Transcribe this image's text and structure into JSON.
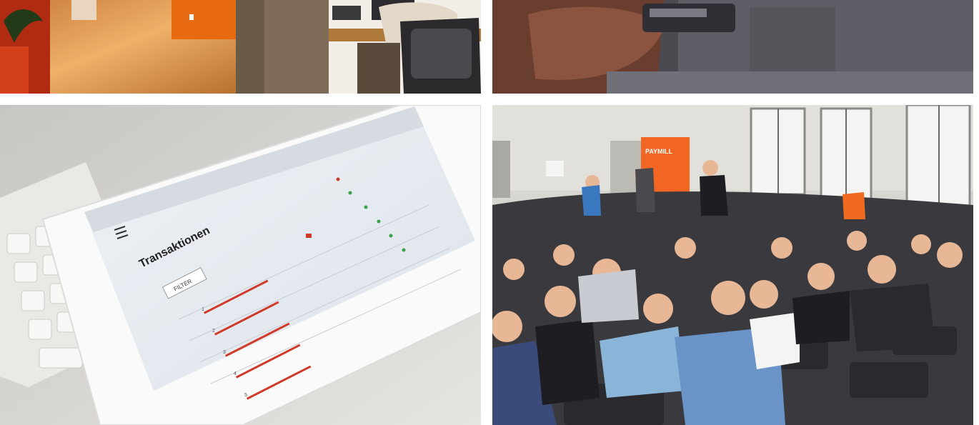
{
  "photos": {
    "office": {
      "icon": "office-desk-photo"
    },
    "printer": {
      "icon": "card-terminal-photo"
    },
    "ipad": {
      "icon": "ipad-on-keyboard-photo",
      "screen_title": "Transaktionen",
      "filter_label": "FILTER",
      "row_numbers": [
        "1",
        "2",
        "3",
        "4",
        "5"
      ]
    },
    "audience": {
      "icon": "lecture-hall-audience-photo",
      "banner_text": "PAYMILL"
    }
  },
  "colors": {
    "office_orange": "#e86a10",
    "paymill_orange": "#f26522",
    "link_red": "#d03a2a",
    "hall_wall": "#d8d6d0"
  }
}
